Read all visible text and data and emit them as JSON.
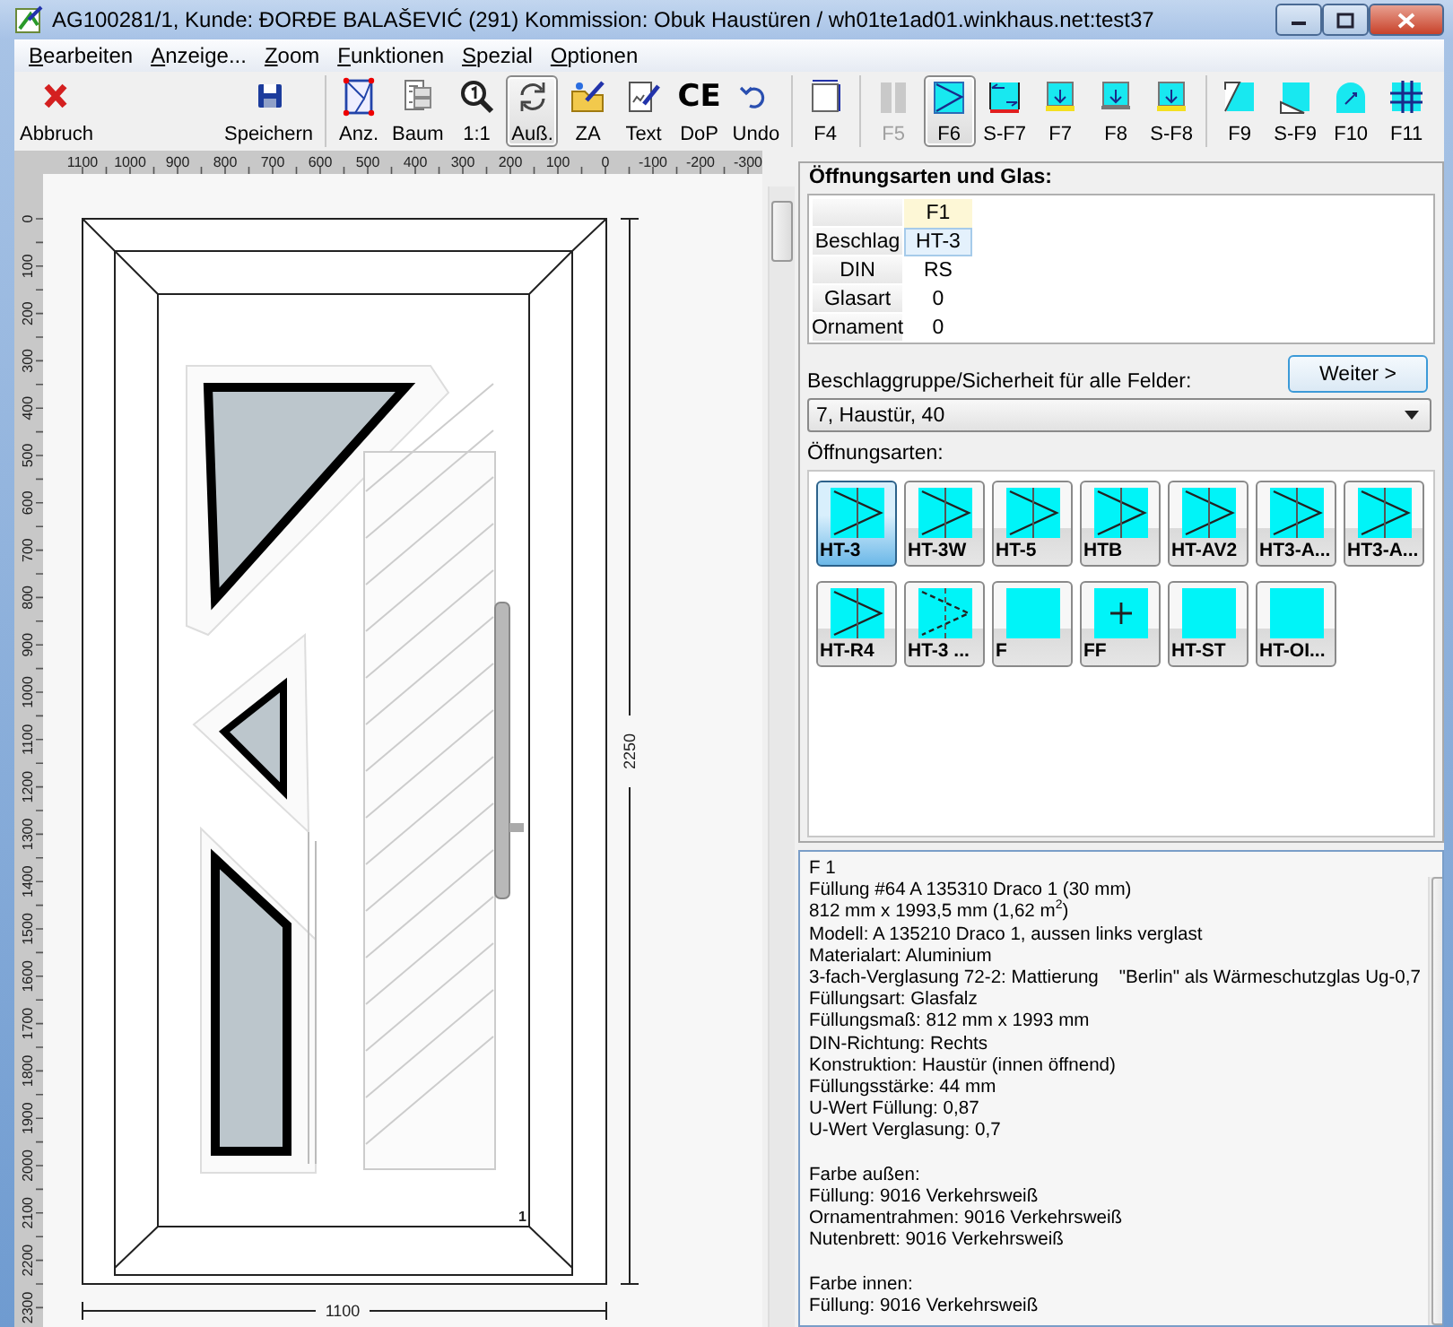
{
  "window": {
    "title": "AG100281/1, Kunde:  ĐORĐE BALAŠEVIĆ (291) Kommission: Obuk Haustüren / wh01te1ad01.winkhaus.net:test37"
  },
  "menu": [
    {
      "label": "Bearbeiten"
    },
    {
      "label": "Anzeige..."
    },
    {
      "label": "Zoom"
    },
    {
      "label": "Funktionen"
    },
    {
      "label": "Spezial"
    },
    {
      "label": "Optionen"
    }
  ],
  "toolbar": [
    {
      "kind": "cross",
      "label": "Abbruch",
      "pressed": false,
      "disabled": false
    },
    {
      "kind": "save",
      "label": "Speichern",
      "pressed": false,
      "disabled": false
    },
    {
      "kind": "separator"
    },
    {
      "kind": "frame",
      "label": "Anz.",
      "pressed": false,
      "disabled": false
    },
    {
      "kind": "tree",
      "label": "Baum",
      "pressed": false,
      "disabled": false
    },
    {
      "kind": "zoom",
      "label": "1:1",
      "pressed": false,
      "disabled": false
    },
    {
      "kind": "rotate",
      "label": "Auß.",
      "pressed": true,
      "disabled": false
    },
    {
      "kind": "folder",
      "label": "ZA",
      "pressed": false,
      "disabled": false
    },
    {
      "kind": "docpen",
      "label": "Text",
      "pressed": false,
      "disabled": false
    },
    {
      "kind": "glyph",
      "glyph": "CE",
      "label": "DoP",
      "pressed": false,
      "disabled": false
    },
    {
      "kind": "undo",
      "label": "Undo",
      "pressed": false,
      "disabled": false
    },
    {
      "kind": "separator"
    },
    {
      "kind": "dimension",
      "label": "F4",
      "pressed": false,
      "disabled": false
    },
    {
      "kind": "separator"
    },
    {
      "kind": "bars",
      "label": "F5",
      "pressed": false,
      "disabled": true
    },
    {
      "kind": "triangle",
      "label": "F6",
      "pressed": true,
      "disabled": false
    },
    {
      "kind": "slide",
      "label": "S-F7",
      "pressed": false,
      "disabled": false
    },
    {
      "kind": "down-yellow",
      "label": "F7",
      "pressed": false,
      "disabled": false
    },
    {
      "kind": "down",
      "label": "F8",
      "pressed": false,
      "disabled": false
    },
    {
      "kind": "down-yellow",
      "label": "S-F8",
      "pressed": false,
      "disabled": false
    },
    {
      "kind": "separator"
    },
    {
      "kind": "corner",
      "label": "F9",
      "pressed": false,
      "disabled": false
    },
    {
      "kind": "corner-low",
      "label": "S-F9",
      "pressed": false,
      "disabled": false
    },
    {
      "kind": "arch",
      "label": "F10",
      "pressed": false,
      "disabled": false
    },
    {
      "kind": "grid",
      "label": "F11",
      "pressed": false,
      "disabled": false
    }
  ],
  "ruler_top": {
    "labels": [
      "1100",
      "1000",
      "900",
      "800",
      "700",
      "600",
      "500",
      "400",
      "300",
      "200",
      "100",
      "0",
      "-100",
      "-200",
      "-300"
    ]
  },
  "ruler_left": {
    "labels": [
      "0",
      "100",
      "200",
      "300",
      "400",
      "500",
      "600",
      "700",
      "800",
      "900",
      "1000",
      "1100",
      "1200",
      "1300",
      "1400",
      "1500",
      "1600",
      "1700",
      "1800",
      "1900",
      "2000",
      "2100",
      "2200",
      "2300"
    ]
  },
  "drawing": {
    "width_label": "1100",
    "height_label": "2250",
    "panel_number": "1"
  },
  "openings": {
    "title": "Öffnungsarten und Glas:",
    "grid": {
      "columns": [
        "F1"
      ],
      "rows": [
        {
          "label": "Beschlag",
          "value": "HT-3",
          "selected": true
        },
        {
          "label": "DIN",
          "value": "RS",
          "selected": false
        },
        {
          "label": "Glasart",
          "value": "0",
          "selected": false
        },
        {
          "label": "Ornament",
          "value": "0",
          "selected": false
        }
      ]
    },
    "next_button": "Weiter >",
    "group_label": "Beschlaggruppe/Sicherheit für alle Felder:",
    "group_select": {
      "value": "7, Haustür, 40"
    },
    "types_label": "Öffnungsarten:",
    "types": [
      {
        "label": "HT-3",
        "kind": "arrow",
        "selected": true
      },
      {
        "label": "HT-3W",
        "kind": "arrow",
        "selected": false
      },
      {
        "label": "HT-5",
        "kind": "arrow",
        "selected": false
      },
      {
        "label": "HTB",
        "kind": "arrow",
        "selected": false
      },
      {
        "label": "HT-AV2",
        "kind": "arrow",
        "selected": false
      },
      {
        "label": "HT3-A...",
        "kind": "arrow",
        "selected": false
      },
      {
        "label": "HT3-A...",
        "kind": "arrow",
        "selected": false
      },
      {
        "label": "HT-R4",
        "kind": "arrow",
        "selected": false
      },
      {
        "label": "HT-3 ...",
        "kind": "dashed",
        "selected": false
      },
      {
        "label": "F",
        "kind": "plain",
        "selected": false
      },
      {
        "label": "FF",
        "kind": "plus",
        "selected": false
      },
      {
        "label": "HT-ST",
        "kind": "plain",
        "selected": false
      },
      {
        "label": "HT-OI...",
        "kind": "plain",
        "selected": false
      }
    ]
  },
  "details": {
    "paragraphs": [
      {
        "lines": [
          "F 1",
          "Füllung #64 A 135310 Draco 1 (30 mm)",
          "812 mm x 1993,5 mm (1,62 m$^{2}$)",
          "Modell: A 135210 Draco 1, aussen links verglast",
          "Materialart: Aluminium",
          "3-fach-Verglasung 72-2: Mattierung    \"Berlin\" als Wärmeschutzglas Ug-0,7",
          "Füllungsart: Glasfalz",
          "Füllungsmaß: 812 mm x 1993 mm",
          "DIN-Richtung: Rechts",
          "Konstruktion: Haustür (innen öffnend)",
          "Füllungsstärke: 44 mm",
          "U-Wert Füllung: 0,87",
          "U-Wert Verglasung: 0,7"
        ]
      },
      {
        "lines": [
          "Farbe außen:",
          "Füllung: 9016 Verkehrsweiß",
          "Ornamentrahmen: 9016 Verkehrsweiß",
          "Nutenbrett: 9016 Verkehrsweiß"
        ]
      },
      {
        "lines": [
          "Farbe innen:",
          "Füllung: 9016 Verkehrsweiß"
        ]
      }
    ]
  }
}
